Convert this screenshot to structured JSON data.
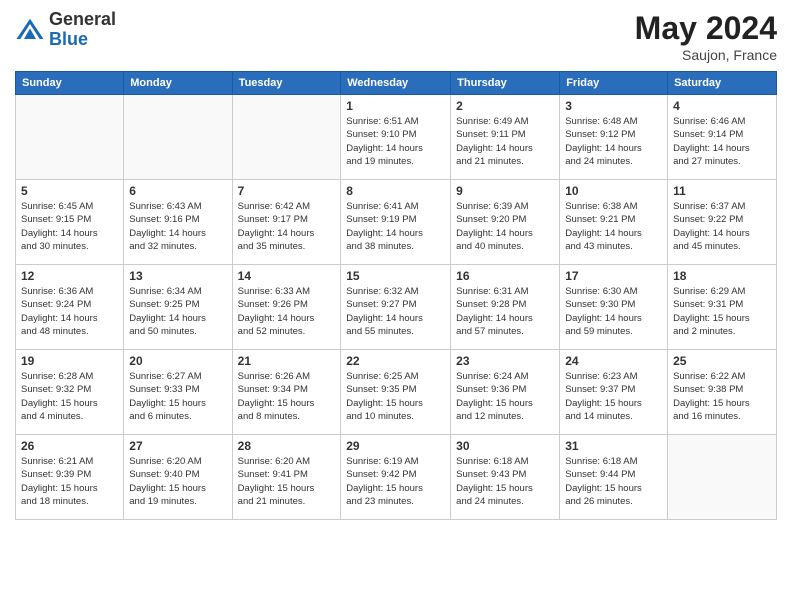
{
  "logo": {
    "general": "General",
    "blue": "Blue"
  },
  "title": {
    "month_year": "May 2024",
    "location": "Saujon, France"
  },
  "headers": [
    "Sunday",
    "Monday",
    "Tuesday",
    "Wednesday",
    "Thursday",
    "Friday",
    "Saturday"
  ],
  "weeks": [
    [
      {
        "day": "",
        "info": ""
      },
      {
        "day": "",
        "info": ""
      },
      {
        "day": "",
        "info": ""
      },
      {
        "day": "1",
        "info": "Sunrise: 6:51 AM\nSunset: 9:10 PM\nDaylight: 14 hours\nand 19 minutes."
      },
      {
        "day": "2",
        "info": "Sunrise: 6:49 AM\nSunset: 9:11 PM\nDaylight: 14 hours\nand 21 minutes."
      },
      {
        "day": "3",
        "info": "Sunrise: 6:48 AM\nSunset: 9:12 PM\nDaylight: 14 hours\nand 24 minutes."
      },
      {
        "day": "4",
        "info": "Sunrise: 6:46 AM\nSunset: 9:14 PM\nDaylight: 14 hours\nand 27 minutes."
      }
    ],
    [
      {
        "day": "5",
        "info": "Sunrise: 6:45 AM\nSunset: 9:15 PM\nDaylight: 14 hours\nand 30 minutes."
      },
      {
        "day": "6",
        "info": "Sunrise: 6:43 AM\nSunset: 9:16 PM\nDaylight: 14 hours\nand 32 minutes."
      },
      {
        "day": "7",
        "info": "Sunrise: 6:42 AM\nSunset: 9:17 PM\nDaylight: 14 hours\nand 35 minutes."
      },
      {
        "day": "8",
        "info": "Sunrise: 6:41 AM\nSunset: 9:19 PM\nDaylight: 14 hours\nand 38 minutes."
      },
      {
        "day": "9",
        "info": "Sunrise: 6:39 AM\nSunset: 9:20 PM\nDaylight: 14 hours\nand 40 minutes."
      },
      {
        "day": "10",
        "info": "Sunrise: 6:38 AM\nSunset: 9:21 PM\nDaylight: 14 hours\nand 43 minutes."
      },
      {
        "day": "11",
        "info": "Sunrise: 6:37 AM\nSunset: 9:22 PM\nDaylight: 14 hours\nand 45 minutes."
      }
    ],
    [
      {
        "day": "12",
        "info": "Sunrise: 6:36 AM\nSunset: 9:24 PM\nDaylight: 14 hours\nand 48 minutes."
      },
      {
        "day": "13",
        "info": "Sunrise: 6:34 AM\nSunset: 9:25 PM\nDaylight: 14 hours\nand 50 minutes."
      },
      {
        "day": "14",
        "info": "Sunrise: 6:33 AM\nSunset: 9:26 PM\nDaylight: 14 hours\nand 52 minutes."
      },
      {
        "day": "15",
        "info": "Sunrise: 6:32 AM\nSunset: 9:27 PM\nDaylight: 14 hours\nand 55 minutes."
      },
      {
        "day": "16",
        "info": "Sunrise: 6:31 AM\nSunset: 9:28 PM\nDaylight: 14 hours\nand 57 minutes."
      },
      {
        "day": "17",
        "info": "Sunrise: 6:30 AM\nSunset: 9:30 PM\nDaylight: 14 hours\nand 59 minutes."
      },
      {
        "day": "18",
        "info": "Sunrise: 6:29 AM\nSunset: 9:31 PM\nDaylight: 15 hours\nand 2 minutes."
      }
    ],
    [
      {
        "day": "19",
        "info": "Sunrise: 6:28 AM\nSunset: 9:32 PM\nDaylight: 15 hours\nand 4 minutes."
      },
      {
        "day": "20",
        "info": "Sunrise: 6:27 AM\nSunset: 9:33 PM\nDaylight: 15 hours\nand 6 minutes."
      },
      {
        "day": "21",
        "info": "Sunrise: 6:26 AM\nSunset: 9:34 PM\nDaylight: 15 hours\nand 8 minutes."
      },
      {
        "day": "22",
        "info": "Sunrise: 6:25 AM\nSunset: 9:35 PM\nDaylight: 15 hours\nand 10 minutes."
      },
      {
        "day": "23",
        "info": "Sunrise: 6:24 AM\nSunset: 9:36 PM\nDaylight: 15 hours\nand 12 minutes."
      },
      {
        "day": "24",
        "info": "Sunrise: 6:23 AM\nSunset: 9:37 PM\nDaylight: 15 hours\nand 14 minutes."
      },
      {
        "day": "25",
        "info": "Sunrise: 6:22 AM\nSunset: 9:38 PM\nDaylight: 15 hours\nand 16 minutes."
      }
    ],
    [
      {
        "day": "26",
        "info": "Sunrise: 6:21 AM\nSunset: 9:39 PM\nDaylight: 15 hours\nand 18 minutes."
      },
      {
        "day": "27",
        "info": "Sunrise: 6:20 AM\nSunset: 9:40 PM\nDaylight: 15 hours\nand 19 minutes."
      },
      {
        "day": "28",
        "info": "Sunrise: 6:20 AM\nSunset: 9:41 PM\nDaylight: 15 hours\nand 21 minutes."
      },
      {
        "day": "29",
        "info": "Sunrise: 6:19 AM\nSunset: 9:42 PM\nDaylight: 15 hours\nand 23 minutes."
      },
      {
        "day": "30",
        "info": "Sunrise: 6:18 AM\nSunset: 9:43 PM\nDaylight: 15 hours\nand 24 minutes."
      },
      {
        "day": "31",
        "info": "Sunrise: 6:18 AM\nSunset: 9:44 PM\nDaylight: 15 hours\nand 26 minutes."
      },
      {
        "day": "",
        "info": ""
      }
    ]
  ]
}
